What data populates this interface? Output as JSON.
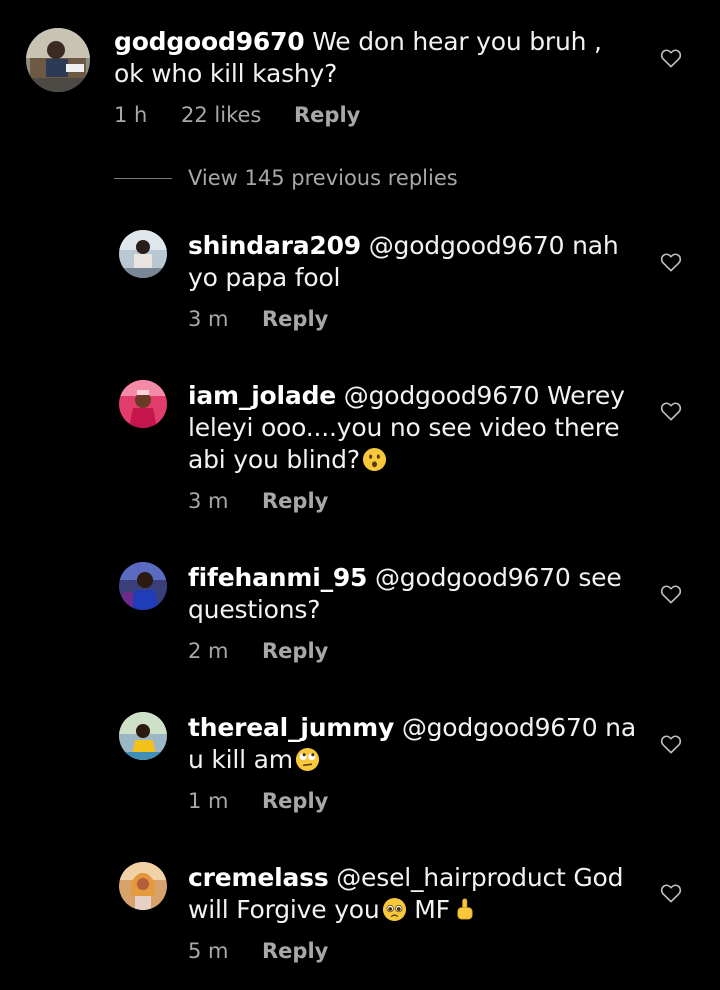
{
  "parent": {
    "username": "godgood9670",
    "text": " We don hear you bruh , ok who kill kashy?",
    "time": "1 h",
    "likes": "22 likes",
    "reply": "Reply"
  },
  "view_previous": "View 145 previous replies",
  "replies": [
    {
      "username": "shindara209",
      "mention": " @godgood9670",
      "text": " nah yo papa fool",
      "time": "3 m",
      "reply": "Reply"
    },
    {
      "username": "iam_jolade",
      "mention": " @godgood9670",
      "text": " Werey leleyi ooo....you no see video there abi you blind?",
      "emoji": "hushed-face-emoji",
      "time": "3 m",
      "reply": "Reply"
    },
    {
      "username": "fifehanmi_95",
      "mention": " @godgood9670",
      "text": " see questions?",
      "time": "2 m",
      "reply": "Reply"
    },
    {
      "username": "thereal_jummy",
      "mention": " @godgood9670",
      "text": " na u kill am",
      "emoji": "eye-roll-emoji",
      "time": "1 m",
      "reply": "Reply"
    },
    {
      "username": "cremelass",
      "mention": " @esel_hairproduct",
      "text": " God will Forgive you",
      "text2": " MF",
      "emoji": "pleading-face-emoji",
      "emoji2": "middle-finger-emoji",
      "time": "5 m",
      "reply": "Reply"
    }
  ],
  "colors": {
    "background": "#000000",
    "text": "#f2f2f2",
    "secondary": "#a8a8a8"
  }
}
